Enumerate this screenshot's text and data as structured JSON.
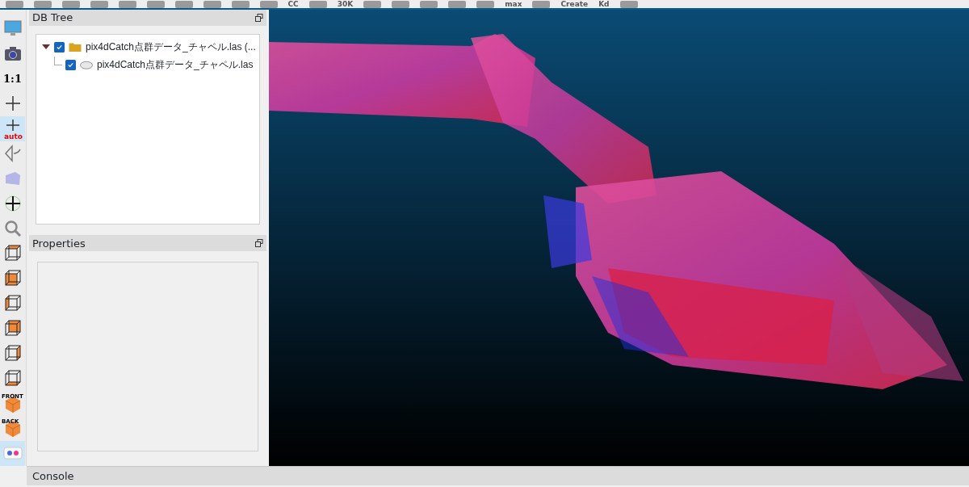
{
  "toolbar": {
    "items": [
      {
        "kind": "icon"
      },
      {
        "kind": "icon"
      },
      {
        "kind": "icon"
      },
      {
        "kind": "icon"
      },
      {
        "kind": "icon"
      },
      {
        "kind": "icon"
      },
      {
        "kind": "icon"
      },
      {
        "kind": "icon"
      },
      {
        "kind": "icon"
      },
      {
        "kind": "icon"
      },
      {
        "kind": "text",
        "label": "CC"
      },
      {
        "kind": "icon"
      },
      {
        "kind": "text",
        "label": "30K"
      },
      {
        "kind": "icon"
      },
      {
        "kind": "icon"
      },
      {
        "kind": "icon"
      },
      {
        "kind": "icon"
      },
      {
        "kind": "icon"
      },
      {
        "kind": "text",
        "label": "max"
      },
      {
        "kind": "icon"
      },
      {
        "kind": "text",
        "label": "Create"
      },
      {
        "kind": "text",
        "label": "Kd"
      },
      {
        "kind": "icon"
      }
    ]
  },
  "view_toolbar": [
    {
      "kind": "display",
      "selected": false
    },
    {
      "kind": "camera",
      "selected": false
    },
    {
      "kind": "text",
      "label": "1:1",
      "selected": false
    },
    {
      "kind": "pivot",
      "selected": false
    },
    {
      "kind": "pivot-auto",
      "label": "auto",
      "selected": true
    },
    {
      "kind": "perspective",
      "selected": false
    },
    {
      "kind": "object",
      "selected": false
    },
    {
      "kind": "move",
      "selected": false
    },
    {
      "kind": "zoom",
      "selected": false
    },
    {
      "kind": "cube-top",
      "selected": false
    },
    {
      "kind": "cube-front",
      "selected": false
    },
    {
      "kind": "cube-left",
      "selected": false
    },
    {
      "kind": "cube-back",
      "selected": false
    },
    {
      "kind": "cube-right",
      "selected": false
    },
    {
      "kind": "cube-bottom",
      "selected": false
    },
    {
      "kind": "labeled-cube",
      "label": "FRONT",
      "selected": false
    },
    {
      "kind": "labeled-cube",
      "label": "BACK",
      "selected": false
    },
    {
      "kind": "stereo",
      "selected": true
    }
  ],
  "db_tree": {
    "title": "DB Tree",
    "items": [
      {
        "label": "pix4dCatch点群データ_チャペル.las (...",
        "kind": "group",
        "checked": true,
        "expanded": true,
        "children": [
          {
            "label": "pix4dCatch点群データ_チャペル.las",
            "kind": "cloud",
            "checked": true
          }
        ]
      }
    ]
  },
  "properties": {
    "title": "Properties"
  },
  "console": {
    "title": "Console"
  }
}
